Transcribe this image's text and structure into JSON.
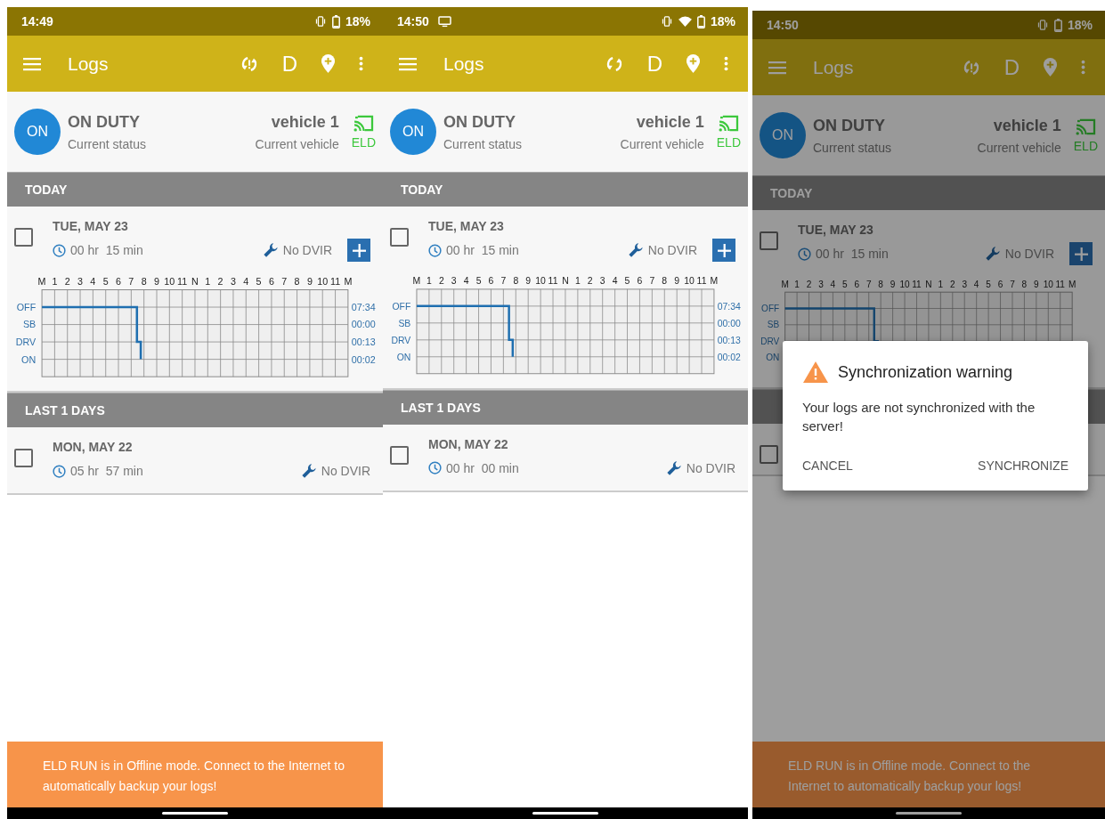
{
  "screens": [
    {
      "status_bar": {
        "time": "14:49",
        "cast": false,
        "wifi": false,
        "battery": "18%"
      },
      "app_bar": {
        "title": "Logs",
        "sync_warning": true,
        "duty_letter": "D"
      },
      "status": {
        "badge": "ON",
        "title": "ON DUTY",
        "subtitle": "Current status",
        "vehicle": "vehicle 1",
        "vehicle_label": "Current vehicle",
        "connection": "ELD"
      },
      "sections": [
        {
          "title": "TODAY",
          "days": [
            {
              "date": "TUE, MAY 23",
              "checked": false,
              "duration": "00 hr  15 min",
              "dvir": "No DVIR",
              "add": true,
              "hour_labels": [
                "M",
                "1",
                "2",
                "3",
                "4",
                "5",
                "6",
                "7",
                "8",
                "9",
                "10",
                "11",
                "N",
                "1",
                "2",
                "3",
                "4",
                "5",
                "6",
                "7",
                "8",
                "9",
                "10",
                "11",
                "M"
              ],
              "row_labels": [
                "OFF",
                "SB",
                "DRV",
                "ON"
              ],
              "totals": [
                "07:34",
                "00:00",
                "00:13",
                "00:02"
              ]
            }
          ]
        },
        {
          "title": "LAST 1 DAYS",
          "days": [
            {
              "date": "MON, MAY 22",
              "checked": false,
              "duration": "05 hr  57 min",
              "dvir": "No DVIR",
              "add": false
            }
          ]
        }
      ],
      "banner": "ELD RUN is in Offline mode. Connect to the Internet to automatically backup your logs!"
    },
    {
      "status_bar": {
        "time": "14:50",
        "cast": true,
        "wifi": true,
        "battery": "18%"
      },
      "app_bar": {
        "title": "Logs",
        "sync_warning": false,
        "duty_letter": "D"
      },
      "status": {
        "badge": "ON",
        "title": "ON DUTY",
        "subtitle": "Current status",
        "vehicle": "vehicle 1",
        "vehicle_label": "Current vehicle",
        "connection": "ELD"
      },
      "sections": [
        {
          "title": "TODAY",
          "days": [
            {
              "date": "TUE, MAY 23",
              "checked": false,
              "duration": "00 hr  15 min",
              "dvir": "No DVIR",
              "add": true,
              "hour_labels": [
                "M",
                "1",
                "2",
                "3",
                "4",
                "5",
                "6",
                "7",
                "8",
                "9",
                "10",
                "11",
                "N",
                "1",
                "2",
                "3",
                "4",
                "5",
                "6",
                "7",
                "8",
                "9",
                "10",
                "11",
                "M"
              ],
              "row_labels": [
                "OFF",
                "SB",
                "DRV",
                "ON"
              ],
              "totals": [
                "07:34",
                "00:00",
                "00:13",
                "00:02"
              ]
            }
          ]
        },
        {
          "title": "LAST 1 DAYS",
          "days": [
            {
              "date": "MON, MAY 22",
              "checked": false,
              "duration": "00 hr  00 min",
              "dvir": "No DVIR",
              "add": false
            }
          ]
        }
      ]
    },
    {
      "status_bar": {
        "time": "14:50",
        "cast": false,
        "wifi": false,
        "battery": "18%"
      },
      "app_bar": {
        "title": "Logs",
        "sync_warning": true,
        "duty_letter": "D"
      },
      "status": {
        "badge": "ON",
        "title": "ON DUTY",
        "subtitle": "Current status",
        "vehicle": "vehicle 1",
        "vehicle_label": "Current vehicle",
        "connection": "ELD"
      },
      "sections": [
        {
          "title": "TODAY",
          "days": [
            {
              "date": "TUE, MAY 23",
              "checked": false,
              "duration": "00 hr  15 min",
              "dvir": "No DVIR",
              "add": true,
              "hour_labels": [
                "M",
                "1",
                "2",
                "3",
                "4",
                "5",
                "6",
                "7",
                "8",
                "9",
                "10",
                "11",
                "N",
                "1",
                "2",
                "3",
                "4",
                "5",
                "6",
                "7",
                "8",
                "9",
                "10",
                "11",
                "M"
              ],
              "row_labels": [
                "OFF",
                "SB",
                "DRV",
                "ON"
              ]
            }
          ]
        },
        {
          "days": [
            {
              "checked": false
            }
          ]
        }
      ],
      "banner": "ELD RUN is in Offline mode. Connect to the Internet to automatically backup your logs!",
      "dialog": {
        "title": "Synchronization warning",
        "message": "Your logs are not synchronized with the server!",
        "buttons": [
          "CANCEL",
          "SYNCHRONIZE"
        ]
      }
    }
  ]
}
